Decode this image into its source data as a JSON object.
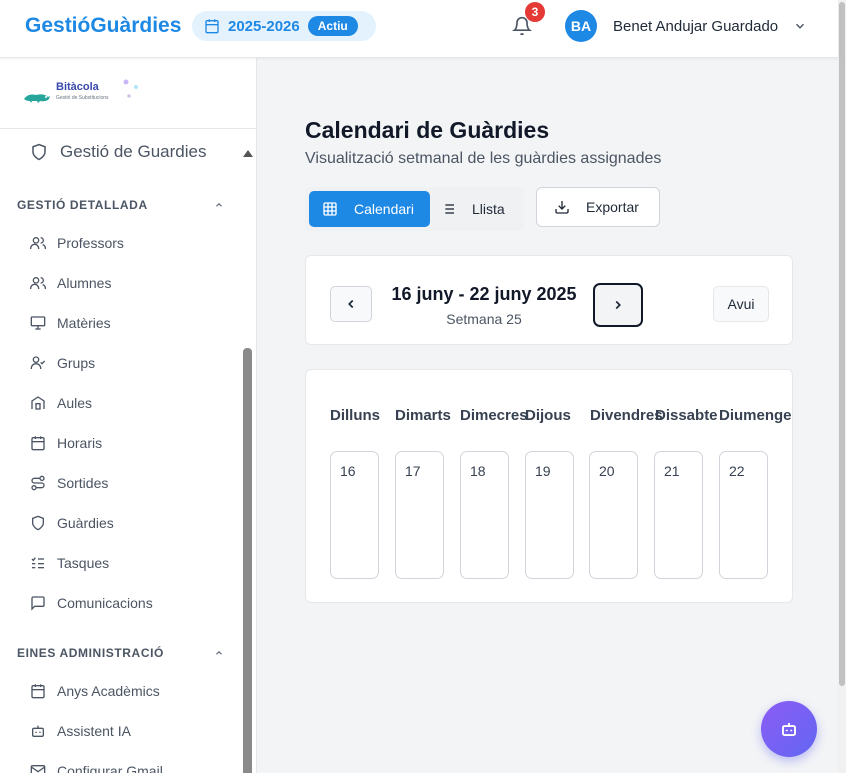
{
  "header": {
    "brand": "GestióGuàrdies",
    "academic_year": "2025-2026",
    "year_status": "Actiu",
    "notification_count": "3",
    "avatar_initials": "BA",
    "user_name": "Benet Andujar Guardado"
  },
  "sidebar": {
    "logo_title": "Bitàcola",
    "logo_subtitle": "Gestió de Substitucions",
    "top_item": "Gestió de Guardies",
    "sections": [
      {
        "title": "GESTIÓ DETALLADA",
        "items": [
          {
            "label": "Professors",
            "icon": "users-icon"
          },
          {
            "label": "Alumnes",
            "icon": "users-icon"
          },
          {
            "label": "Matèries",
            "icon": "presentation-icon"
          },
          {
            "label": "Grups",
            "icon": "user-check-icon"
          },
          {
            "label": "Aules",
            "icon": "building-icon"
          },
          {
            "label": "Horaris",
            "icon": "calendar-icon"
          },
          {
            "label": "Sortides",
            "icon": "route-icon"
          },
          {
            "label": "Guàrdies",
            "icon": "shield-icon"
          },
          {
            "label": "Tasques",
            "icon": "list-checks-icon"
          },
          {
            "label": "Comunicacions",
            "icon": "message-icon"
          }
        ]
      },
      {
        "title": "EINES ADMINISTRACIÓ",
        "items": [
          {
            "label": "Anys Acadèmics",
            "icon": "calendar-icon"
          },
          {
            "label": "Assistent IA",
            "icon": "bot-icon"
          },
          {
            "label": "Configurar Gmail",
            "icon": "mail-icon"
          }
        ]
      }
    ]
  },
  "main": {
    "title": "Calendari de Guàrdies",
    "subtitle": "Visualització setmanal de les guàrdies assignades",
    "view_calendar": "Calendari",
    "view_list": "Llista",
    "export": "Exportar",
    "week_range": "16 juny - 22 juny 2025",
    "week_number": "Setmana 25",
    "today": "Avui",
    "days": [
      {
        "name": "Dilluns",
        "date": "16"
      },
      {
        "name": "Dimarts",
        "date": "17"
      },
      {
        "name": "Dimecres",
        "date": "18"
      },
      {
        "name": "Dijous",
        "date": "19"
      },
      {
        "name": "Divendres",
        "date": "20"
      },
      {
        "name": "Dissabte",
        "date": "21"
      },
      {
        "name": "Diumenge",
        "date": "22"
      }
    ]
  },
  "colors": {
    "accent": "#1e88e5",
    "badge_red": "#e53935",
    "fab_gradient_start": "#8b5cf6",
    "fab_gradient_end": "#6366f1"
  }
}
